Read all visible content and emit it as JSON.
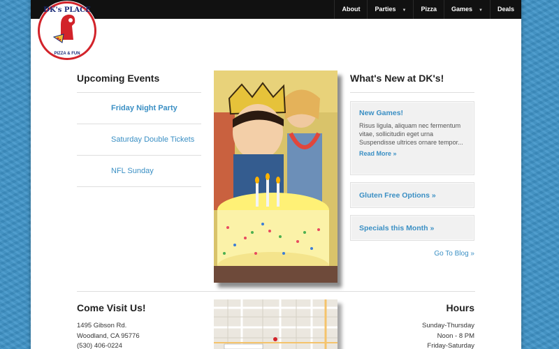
{
  "brand": {
    "logo_text_top": "DK's PLACE",
    "logo_text_bottom": "PIZZA & FUN",
    "colors": {
      "red": "#d2232a",
      "navy": "#1c2c7a",
      "link": "#3a8fc4",
      "bar": "#111111"
    }
  },
  "nav": {
    "items": [
      {
        "label": "About",
        "has_dropdown": false
      },
      {
        "label": "Parties",
        "has_dropdown": true,
        "icon": "caret-down-icon"
      },
      {
        "label": "Pizza",
        "has_dropdown": false
      },
      {
        "label": "Games",
        "has_dropdown": true,
        "icon": "caret-down-icon"
      },
      {
        "label": "Deals",
        "has_dropdown": false
      }
    ]
  },
  "events": {
    "title": "Upcoming Events",
    "items": [
      {
        "label": "Friday Night Party",
        "bold": true
      },
      {
        "label": "Saturday Double Tickets",
        "bold": false
      },
      {
        "label": "NFL Sunday",
        "bold": false
      }
    ]
  },
  "news": {
    "title": "What's New at DK's!",
    "feature": {
      "title": "New Games!",
      "body": "Risus ligula, aliquam nec fermentum vitae, sollicitudin eget urna Suspendisse ultrices ornare tempor...",
      "more": "Read More »"
    },
    "links": [
      "Gluten Free Options »",
      "Specials this Month »"
    ],
    "blog_link": "Go To Blog »"
  },
  "visit": {
    "title": "Come Visit Us!",
    "lines": [
      "1495 Gibson Rd.",
      "Woodland, CA 95776",
      "(530) 406-0224"
    ]
  },
  "hours": {
    "title": "Hours",
    "lines": [
      "Sunday-Thursday",
      "Noon - 8 PM",
      "Friday-Saturday"
    ]
  }
}
